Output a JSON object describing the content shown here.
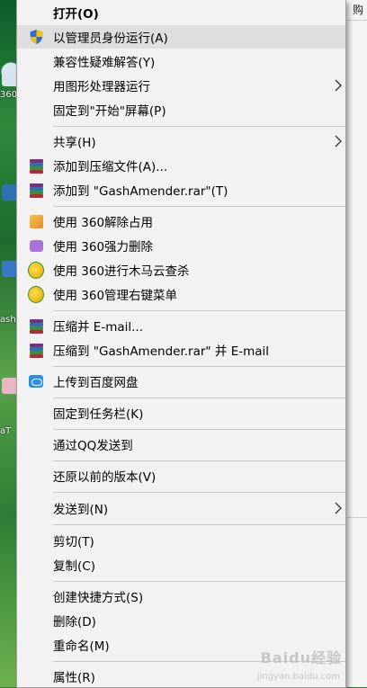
{
  "menu": {
    "items": [
      {
        "label": "打开(O)",
        "bold": true
      },
      {
        "label": "以管理员身份运行(A)",
        "icon": "shield-icon",
        "highlighted": true
      },
      {
        "label": "兼容性疑难解答(Y)"
      },
      {
        "label": "用图形处理器运行",
        "submenu": true
      },
      {
        "label": "固定到\"开始\"屏幕(P)"
      },
      {
        "label": "共享(H)",
        "submenu": true
      },
      {
        "label": "添加到压缩文件(A)...",
        "icon": "winrar-icon"
      },
      {
        "label": "添加到 \"GashAmender.rar\"(T)",
        "icon": "winrar-icon"
      },
      {
        "label": "使用 360解除占用",
        "icon": "360-unlock-icon"
      },
      {
        "label": "使用 360强力删除",
        "icon": "360-delete-icon"
      },
      {
        "label": "使用 360进行木马云查杀",
        "icon": "360-scan-icon"
      },
      {
        "label": "使用 360管理右键菜单",
        "icon": "360-menu-icon"
      },
      {
        "label": "压缩并 E-mail...",
        "icon": "winrar-icon"
      },
      {
        "label": "压缩到 \"GashAmender.rar\" 并 E-mail",
        "icon": "winrar-icon"
      },
      {
        "label": "上传到百度网盘",
        "icon": "baidu-netdisk-icon"
      },
      {
        "label": "固定到任务栏(K)"
      },
      {
        "label": "通过QQ发送到"
      },
      {
        "label": "还原以前的版本(V)"
      },
      {
        "label": "发送到(N)",
        "submenu": true
      },
      {
        "label": "剪切(T)"
      },
      {
        "label": "复制(C)"
      },
      {
        "label": "创建快捷方式(S)"
      },
      {
        "label": "删除(D)"
      },
      {
        "label": "重命名(M)"
      },
      {
        "label": "属性(R)"
      }
    ]
  },
  "desktop": {
    "left_labels": [
      "360",
      "ash",
      "aT"
    ],
    "right_top_label": "购"
  },
  "watermark": {
    "brand": "Baidu经验",
    "url": "jingyan.baidu.com"
  },
  "colors": {
    "menu_bg": "#f2f2f2",
    "highlight": "#dedede",
    "separator": "#c8c8c8"
  }
}
